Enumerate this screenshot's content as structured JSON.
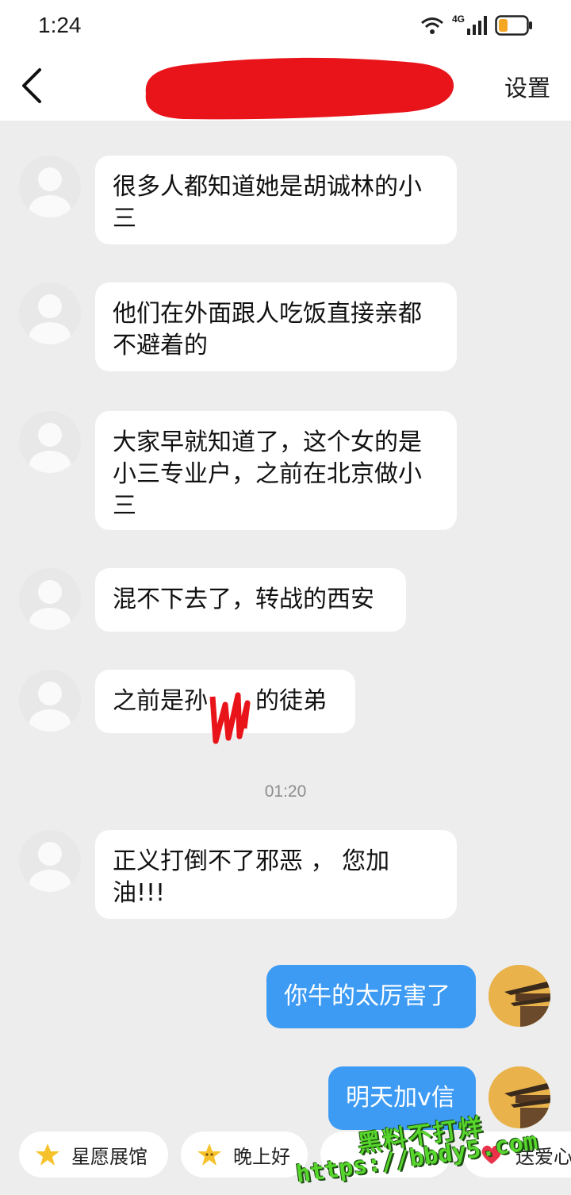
{
  "status_bar": {
    "time": "1:24",
    "network": "4G",
    "icons": [
      "wifi-icon",
      "signal-icon",
      "battery-icon"
    ]
  },
  "header": {
    "back_icon": "chevron-left-icon",
    "settings_label": "设置",
    "title_redaction_color": "#e8141a"
  },
  "messages": [
    {
      "side": "in",
      "text": "很多人都知道她是胡诚林的小三"
    },
    {
      "side": "in",
      "text": "他们在外面跟人吃饭直接亲都不避着的"
    },
    {
      "side": "in",
      "text": "大家早就知道了，这个女的是小三专业户，之前在北京做小三"
    },
    {
      "side": "in",
      "text": "混不下去了，转战的西安"
    },
    {
      "side": "in",
      "text": "之前是孙"
    },
    {
      "side": "in",
      "text": "的徒弟"
    },
    {
      "side": "in",
      "text": "正义打倒不了邪恶 ， 您加油!!!"
    },
    {
      "side": "out",
      "text": "你牛的太厉害了"
    },
    {
      "side": "out",
      "text": "明天加v信"
    }
  ],
  "timestamp": "01:20",
  "quick_replies": [
    {
      "label": "星愿展馆",
      "icon": "star-icon"
    },
    {
      "label": "晚上好",
      "icon": "star-face-icon"
    },
    {
      "label": "送爱心",
      "icon": "heart-icon"
    }
  ],
  "watermark": {
    "line1": "黑料不打烊",
    "line2": "https://bbdy5.com"
  },
  "colors": {
    "chat_background": "#ededed",
    "incoming_bubble": "#ffffff",
    "outgoing_bubble": "#3d9bf3",
    "redaction": "#e8141a",
    "watermark": "#57d62c"
  }
}
